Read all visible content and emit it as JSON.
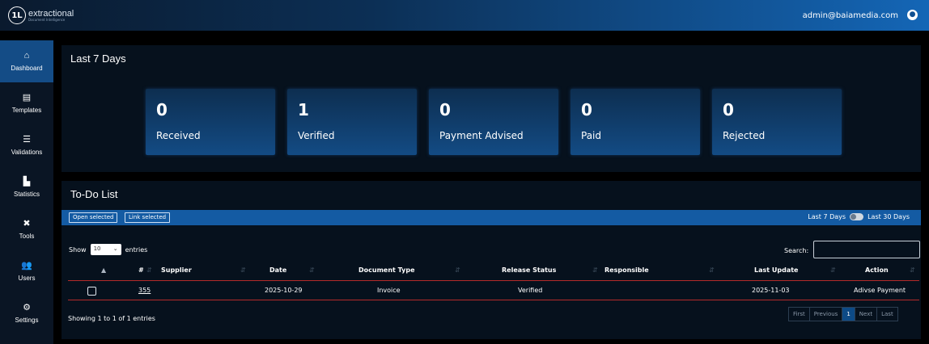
{
  "header": {
    "logo_mark": "1L",
    "logo_name": "extractional",
    "logo_tagline": "Document Intelligence",
    "user_email": "admin@baiamedia.com",
    "globe_icon": "globe-icon"
  },
  "sidebar": {
    "items": [
      {
        "label": "Dashboard",
        "icon": "home-icon",
        "glyph": "⌂",
        "active": true
      },
      {
        "label": "Templates",
        "icon": "file-icon",
        "glyph": "▤"
      },
      {
        "label": "Validations",
        "icon": "list-check-icon",
        "glyph": "☰"
      },
      {
        "label": "Statistics",
        "icon": "chart-icon",
        "glyph": "▙"
      },
      {
        "label": "Tools",
        "icon": "tools-icon",
        "glyph": "✖"
      },
      {
        "label": "Users",
        "icon": "users-icon",
        "glyph": "👥"
      },
      {
        "label": "Settings",
        "icon": "gears-icon",
        "glyph": "⚙"
      }
    ]
  },
  "summary": {
    "title": "Last 7 Days",
    "stats": [
      {
        "value": "0",
        "label": "Received"
      },
      {
        "value": "1",
        "label": "Verified"
      },
      {
        "value": "0",
        "label": "Payment Advised"
      },
      {
        "value": "0",
        "label": "Paid"
      },
      {
        "value": "0",
        "label": "Rejected"
      }
    ]
  },
  "todo": {
    "title": "To-Do List",
    "open_selected": "Open selected",
    "link_selected": "Link selected",
    "range_left": "Last 7 Days",
    "range_right": "Last 30 Days",
    "show_label": "Show",
    "entries_value": "10",
    "entries_label": "entries",
    "search_label": "Search:",
    "columns": [
      "#",
      "Supplier",
      "Date",
      "Document Type",
      "Release Status",
      "Responsible",
      "Last Update",
      "Action"
    ],
    "rows": [
      {
        "id": "355",
        "supplier": "",
        "date": "2025-10-29",
        "doc_type": "Invoice",
        "status": "Verified",
        "responsible": "",
        "last_update": "2025-11-03",
        "action": "Adivse Payment"
      }
    ],
    "showing": "Showing 1 to 1 of 1 entries",
    "pager": {
      "first": "First",
      "previous": "Previous",
      "current": "1",
      "next": "Next",
      "last": "Last"
    }
  }
}
